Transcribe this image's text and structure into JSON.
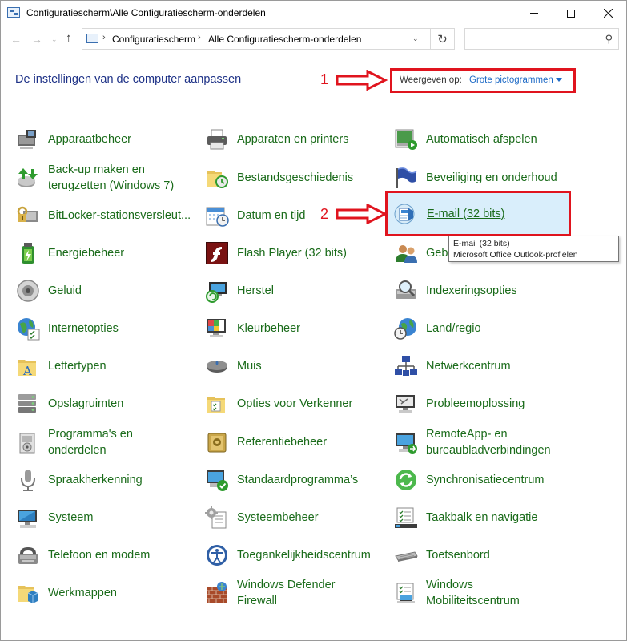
{
  "window": {
    "title": "Configuratiescherm\\Alle Configuratiescherm-onderdelen",
    "minimize_glyph": "—",
    "maximize_glyph": "□",
    "close_glyph": "✕"
  },
  "address_bar": {
    "crumbs": [
      "Configuratiescherm",
      "Alle Configuratiescherm-onderdelen"
    ],
    "search_placeholder": ""
  },
  "header": {
    "title": "De instellingen van de computer aanpassen",
    "view_by_label": "Weergeven op:",
    "view_by_value": "Grote pictogrammen"
  },
  "annotations": {
    "marker_1": "1",
    "marker_2": "2",
    "color": "#e0141e"
  },
  "tooltip": {
    "line1": "E-mail (32 bits)",
    "line2": "Microsoft Office Outlook-profielen"
  },
  "columns": [
    [
      {
        "label": "Apparaatbeheer",
        "icon": "device-manager-icon"
      },
      {
        "label": "Back-up maken en terugzetten (Windows 7)",
        "line1": "Back-up maken en",
        "line2": "terugzetten (Windows 7)",
        "icon": "backup-icon"
      },
      {
        "label": "BitLocker-stationsversleut...",
        "icon": "bitlocker-icon"
      },
      {
        "label": "Energiebeheer",
        "icon": "power-icon"
      },
      {
        "label": "Geluid",
        "icon": "sound-icon"
      },
      {
        "label": "Internetopties",
        "icon": "internet-options-icon"
      },
      {
        "label": "Lettertypen",
        "icon": "fonts-icon"
      },
      {
        "label": "Opslagruimten",
        "icon": "storage-spaces-icon"
      },
      {
        "label": "Programma's en onderdelen",
        "line1": "Programma's en",
        "line2": "onderdelen",
        "icon": "programs-icon"
      },
      {
        "label": "Spraakherkenning",
        "icon": "microphone-icon"
      },
      {
        "label": "Systeem",
        "icon": "system-icon"
      },
      {
        "label": "Telefoon en modem",
        "icon": "phone-modem-icon"
      },
      {
        "label": "Werkmappen",
        "icon": "work-folders-icon"
      }
    ],
    [
      {
        "label": "Apparaten en printers",
        "icon": "printer-icon"
      },
      {
        "label": "Bestandsgeschiedenis",
        "icon": "file-history-icon"
      },
      {
        "label": "Datum en tijd",
        "icon": "date-time-icon"
      },
      {
        "label": "Flash Player (32 bits)",
        "icon": "flash-icon"
      },
      {
        "label": "Herstel",
        "icon": "recovery-icon"
      },
      {
        "label": "Kleurbeheer",
        "icon": "color-management-icon"
      },
      {
        "label": "Muis",
        "icon": "mouse-icon"
      },
      {
        "label": "Opties voor Verkenner",
        "icon": "explorer-options-icon"
      },
      {
        "label": "Referentiebeheer",
        "icon": "credential-manager-icon"
      },
      {
        "label": "Standaardprogramma’s",
        "icon": "default-programs-icon"
      },
      {
        "label": "Systeembeheer",
        "icon": "admin-tools-icon"
      },
      {
        "label": "Toegankelijkheidscentrum",
        "icon": "accessibility-icon"
      },
      {
        "label": "Windows Defender Firewall",
        "line1": "Windows Defender",
        "line2": "Firewall",
        "icon": "firewall-icon"
      }
    ],
    [
      {
        "label": "Automatisch afspelen",
        "icon": "autoplay-icon"
      },
      {
        "label": "Beveiliging en onderhoud",
        "icon": "security-flag-icon"
      },
      {
        "label": "E-mail (32 bits)",
        "icon": "mail-icon"
      },
      {
        "label": "Gebruikersaccounts",
        "visible": "Geb",
        "icon": "user-accounts-icon"
      },
      {
        "label": "Indexeringsopties",
        "icon": "indexing-icon"
      },
      {
        "label": "Land/regio",
        "icon": "region-icon"
      },
      {
        "label": "Netwerkcentrum",
        "icon": "network-icon"
      },
      {
        "label": "Probleemoplossing",
        "icon": "troubleshooting-icon"
      },
      {
        "label": "RemoteApp- en bureaubladverbindingen",
        "line1": "RemoteApp- en",
        "line2": "bureaubladverbindingen",
        "icon": "remoteapp-icon"
      },
      {
        "label": "Synchronisatiecentrum",
        "icon": "sync-icon"
      },
      {
        "label": "Taakbalk en navigatie",
        "icon": "taskbar-icon"
      },
      {
        "label": "Toetsenbord",
        "icon": "keyboard-icon"
      },
      {
        "label": "Windows Mobiliteitscentrum",
        "line1": "Windows",
        "line2": "Mobiliteitscentrum",
        "icon": "mobility-center-icon"
      }
    ]
  ]
}
